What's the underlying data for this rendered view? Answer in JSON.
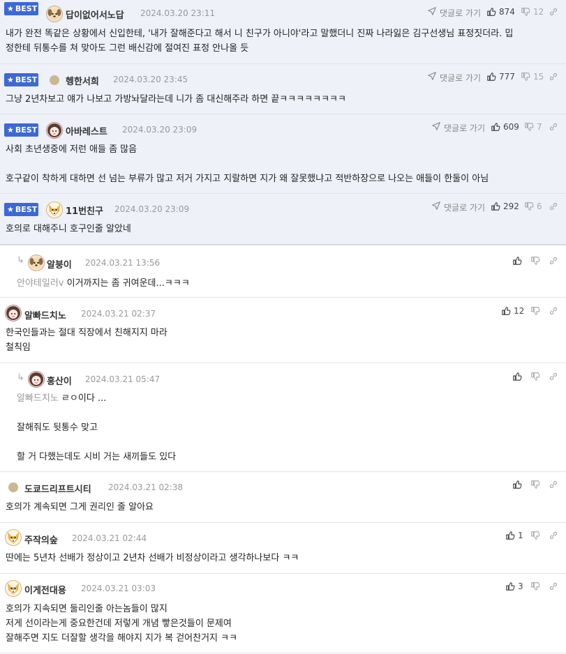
{
  "ui": {
    "best_label": "BEST",
    "goto_label": "댓글로 가기"
  },
  "best_comments": [
    {
      "nick": "답이없어서노답",
      "date": "2024.03.20 23:11",
      "likes": "874",
      "dislikes": "12",
      "text": "내가 완전 똑같은 상황에서 신입한테, '내가 잘해준다고 해서 니 친구가 아니야'라고 말했더니 진짜 나라잃은 김구선생님 표정짓더라. 밉\n정한테 뒤통수를 쳐 맞아도 그런 배신감에 절여진 표정 안나올 듯"
    },
    {
      "nick": "헹한서희",
      "date": "2024.03.20 23:45",
      "likes": "777",
      "dislikes": "15",
      "text": "그냥 2년차보고 얘가 나보고 가방놔달라는데 니가 좀 대신해주라 하면 끝ㅋㅋㅋㅋㅋㅋㅋㅋ"
    },
    {
      "nick": "아바레스트",
      "date": "2024.03.20 23:09",
      "likes": "609",
      "dislikes": "7",
      "text": "사회 초년생중에 저런 애들 좀 많음\n\n호구같이 착하게 대하면 선 넘는 부류가 많고 저거 가지고 지랄하면 지가 왜 잘못했냐고 적반하장으로 나오는 애들이 한둘이 아님"
    },
    {
      "nick": "11번친구",
      "date": "2024.03.20 23:09",
      "likes": "292",
      "dislikes": "6",
      "text": "호의로 대해주니 호구인줄 알았네"
    }
  ],
  "comments": [
    {
      "nick": "알붕이",
      "date": "2024.03.21 13:56",
      "likes": "",
      "quote": "안야테일러v",
      "text": " 이거까지는 좀 귀여운데...ㅋㅋㅋ"
    },
    {
      "nick": "알빠드치노",
      "date": "2024.03.21 02:37",
      "likes": "12",
      "text": "한국인들과는 절대 직장에서 친해지지 마라\n철칙임"
    },
    {
      "nick": "홍산이",
      "date": "2024.03.21 05:47",
      "likes": "",
      "quote": "알빠드치노",
      "text": " ㄹㅇ이다 ...\n\n잘해줘도 뒷통수 맞고\n\n할 거 다했는데도 시비 거는 새끼들도 있다"
    },
    {
      "nick": "도쿄드리프트시티",
      "date": "2024.03.21 02:38",
      "likes": "",
      "text": "호의가 계속되면 그게 권리인 줄 알아요"
    },
    {
      "nick": "주작의숲",
      "date": "2024.03.21 02:44",
      "likes": "1",
      "text": "딴에는 5년차 선배가 정상이고 2년차 선배가 비정상이라고 생각하나보다 ㅋㅋ"
    },
    {
      "nick": "이게전대용",
      "date": "2024.03.21 03:03",
      "likes": "3",
      "text": "호의가 지속되면 둘리인줄 아는놈들이 많지\n저게 선이라는게 중요한건데 저렇게 개념 빻은것들이 문제여\n잘해주면 지도 더잘할 생각을 해야지 지가 복 걷어찬거지 ㅋㅋ"
    }
  ],
  "colors": {
    "best_bg": "#eef1f8",
    "badge": "#3d68d6",
    "border": "#dfe3ea"
  }
}
